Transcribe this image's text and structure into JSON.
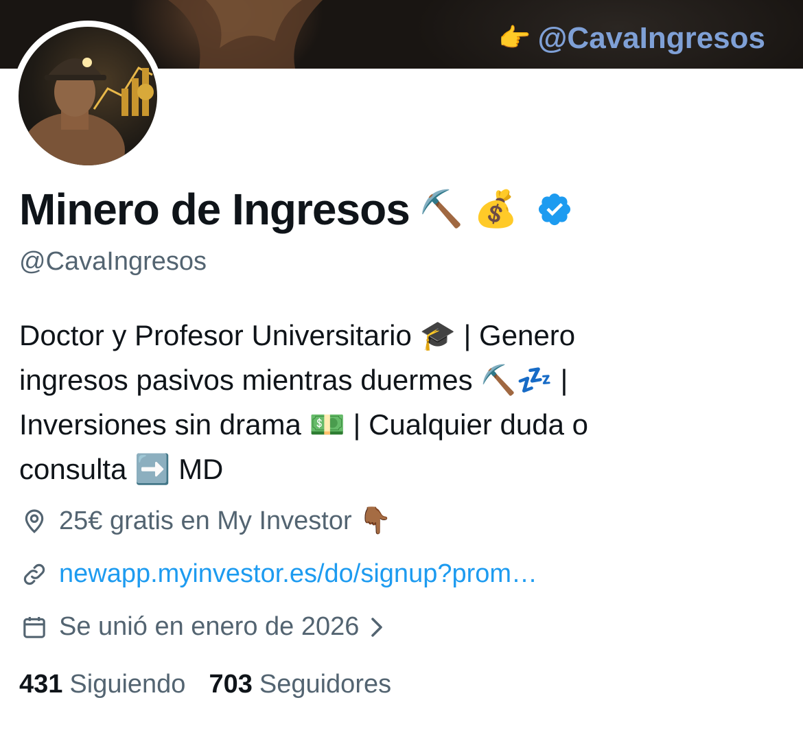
{
  "banner": {
    "handle_text": "@CavaIngresos",
    "hand_emoji": "👉"
  },
  "profile": {
    "display_name": "Minero de Ingresos",
    "name_emojis": "⛏️ 💰",
    "handle": "@CavaIngresos",
    "verified_color": "#1d9bf0",
    "bio_lines": [
      "Doctor y Profesor Universitario 🎓 | Genero",
      "ingresos pasivos mientras duermes ⛏️💤 |",
      "Inversiones sin drama 💵 | Cualquier duda o",
      "consulta ➡️ MD"
    ],
    "location": "25€ gratis en My Investor 👇🏾",
    "link": "newapp.myinvestor.es/do/signup?prom…",
    "joined": "Se unió en enero de 2026"
  },
  "stats": {
    "following_count": "431",
    "following_label": "Siguiendo",
    "followers_count": "703",
    "followers_label": "Seguidores"
  },
  "icons": {
    "location": "map-pin-icon",
    "link": "link-icon",
    "calendar": "calendar-icon",
    "verified": "verified-badge-icon",
    "chevron": "chevron-right-icon"
  }
}
